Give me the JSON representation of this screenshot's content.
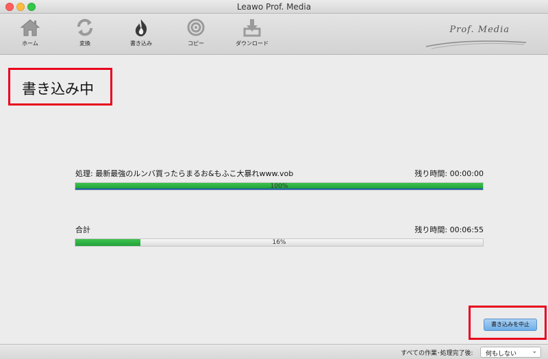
{
  "window": {
    "title": "Leawo Prof. Media"
  },
  "toolbar": {
    "items": [
      {
        "label": "ホーム",
        "icon": "home-icon"
      },
      {
        "label": "変換",
        "icon": "convert-icon"
      },
      {
        "label": "書き込み",
        "icon": "burn-icon"
      },
      {
        "label": "コピー",
        "icon": "copy-icon"
      },
      {
        "label": "ダウンロード",
        "icon": "download-icon"
      }
    ],
    "brand": "Prof. Media"
  },
  "main": {
    "title": "書き込み中",
    "current": {
      "label": "処理: 最新最強のルンバ買ったらまるお&もふこ大暴れwww.vob",
      "remaining": "残り時間: 00:00:00",
      "progress_text": "100%",
      "progress": 100
    },
    "total": {
      "label": "合計",
      "remaining": "残り時間: 00:06:55",
      "progress_text": "16%",
      "progress": 16
    },
    "stop_button": "書き込みを中止"
  },
  "status": {
    "after_label": "すべての作業･処理完了後:",
    "after_value": "何もしない"
  },
  "colors": {
    "highlight": "#e8001c",
    "progress_green": "#2fb344",
    "button_blue": "#8cc0ee"
  }
}
